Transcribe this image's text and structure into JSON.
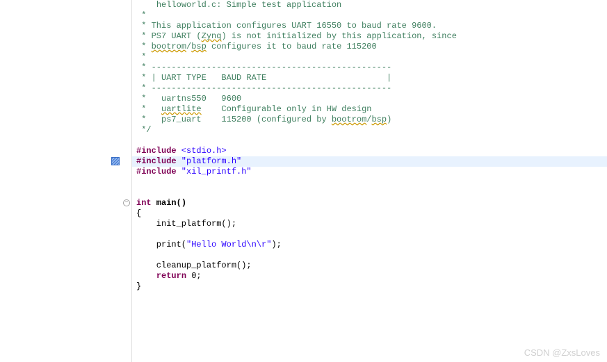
{
  "comment": {
    "l0": "helloworld.c: Simple test application",
    "l1": " *",
    "l2": " * This application configures UART 16550 to baud rate 9600.",
    "l3_a": " * PS7 UART (",
    "l3_b": "Zynq",
    "l3_c": ") is not initialized by this application, since",
    "l4_a": " * ",
    "l4_b": "bootrom",
    "l4_c": "/",
    "l4_d": "bsp",
    "l4_e": " configures it to baud rate 115200",
    "l5": " *",
    "l6": " * ------------------------------------------------",
    "l7": " * | UART TYPE   BAUD RATE                        |",
    "l8": " * ------------------------------------------------",
    "l9": " *   uartns550   9600",
    "l10_a": " *   ",
    "l10_b": "uartlite",
    "l10_c": "    Configurable only in HW design",
    "l11_a": " *   ps7_uart    115200 (configured by ",
    "l11_b": "bootrom",
    "l11_c": "/",
    "l11_d": "bsp",
    "l11_e": ")",
    "l12": " */"
  },
  "includes": {
    "kw": "#include",
    "i1": " <stdio.h>",
    "i2": " \"platform.h\"",
    "i3": " \"xil_printf.h\""
  },
  "code": {
    "kw_int": "int",
    "main_sig": " main()",
    "brace_open": "{",
    "init": "    init_platform();",
    "print_a": "    print(",
    "print_str": "\"Hello World\\n\\r\"",
    "print_b": ");",
    "cleanup": "    cleanup_platform();",
    "kw_return": "return",
    "return_rest": " 0;",
    "return_indent": "    ",
    "brace_close": "}"
  },
  "watermark": "CSDN @ZxsLoves"
}
